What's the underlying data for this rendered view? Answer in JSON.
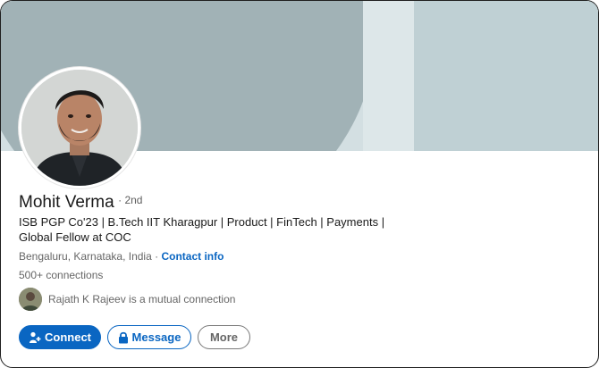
{
  "profile": {
    "name": "Mohit Verma",
    "degree": "2nd",
    "headline_line1": "ISB PGP Co'23 | B.Tech IIT Kharagpur | Product | FinTech | Payments |",
    "headline_line2": "Global Fellow at COC",
    "location": "Bengaluru, Karnataka, India",
    "separator": "·",
    "contact_label": "Contact info",
    "connections": "500+ connections",
    "mutual_text": "Rajath K Rajeev is a mutual connection"
  },
  "actions": {
    "connect_label": "Connect",
    "message_label": "Message",
    "more_label": "More"
  },
  "icons": {
    "connect": "add-person-icon",
    "message": "lock-icon"
  },
  "colors": {
    "brand_blue": "#0a66c2",
    "cover_dark": "#a1b2b6",
    "cover_light": "#d3dfe2"
  }
}
